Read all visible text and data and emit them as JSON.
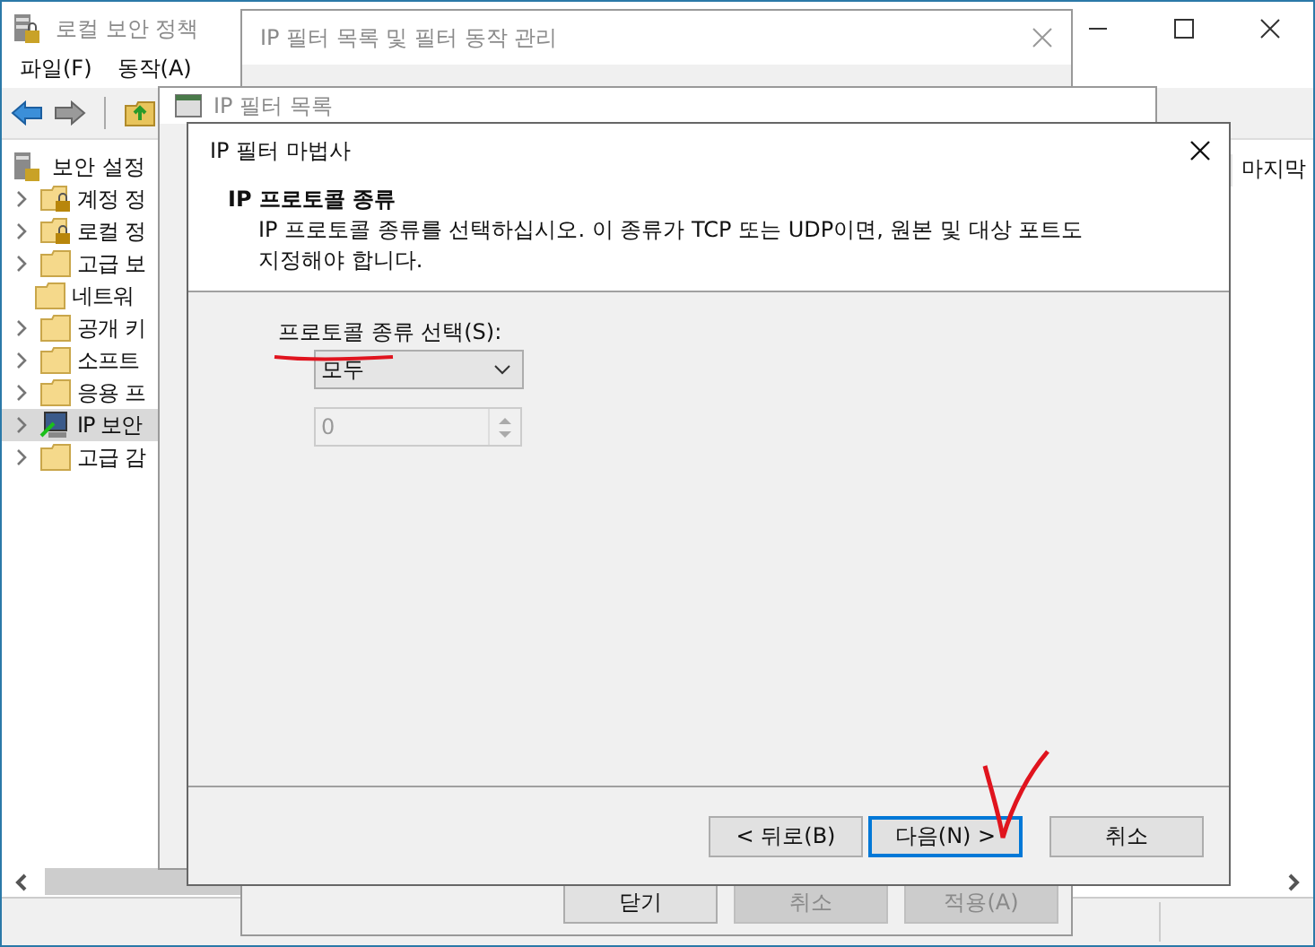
{
  "main_window": {
    "title": "로컬 보안 정책",
    "menu": [
      "파일(F)",
      "동작(A)"
    ],
    "tree": {
      "label": "보안 설정",
      "children": [
        {
          "label": "계정 정",
          "kind": "locked-folder",
          "expandable": true,
          "selected": false
        },
        {
          "label": "로컬 정",
          "kind": "locked-folder",
          "expandable": true,
          "selected": false
        },
        {
          "label": "고급 보",
          "kind": "folder",
          "expandable": true,
          "selected": false
        },
        {
          "label": "네트워",
          "kind": "folder",
          "expandable": false,
          "selected": false
        },
        {
          "label": "공개 키",
          "kind": "folder",
          "expandable": true,
          "selected": false
        },
        {
          "label": "소프트",
          "kind": "folder",
          "expandable": true,
          "selected": false
        },
        {
          "label": "응용 프",
          "kind": "folder",
          "expandable": true,
          "selected": false
        },
        {
          "label": "IP 보안",
          "kind": "computer",
          "expandable": true,
          "selected": true
        },
        {
          "label": "고급 감",
          "kind": "folder",
          "expandable": true,
          "selected": false
        }
      ]
    },
    "column_header": "마지막"
  },
  "filter_manager": {
    "title": "IP 필터 목록 및 필터 동작 관리",
    "buttons": [
      {
        "label": "닫기",
        "disabled": false
      },
      {
        "label": "취소",
        "disabled": true
      },
      {
        "label": "적용(A)",
        "disabled": true
      }
    ]
  },
  "filter_list": {
    "title": "IP 필터 목록"
  },
  "wizard": {
    "title": "IP 필터 마법사",
    "heading": "IP 프로토콜 종류",
    "description_lines": [
      "IP 프로토콜 종류를 선택하십시오. 이 종류가 TCP 또는 UDP이면, 원본 및 대상 포트도",
      "지정해야 합니다."
    ],
    "protocol_label": "프로토콜 종류 선택(S):",
    "protocol_value": "모두",
    "port": {
      "value": "0",
      "disabled": true
    },
    "buttons": [
      {
        "label": "< 뒤로(B)",
        "focused": false
      },
      {
        "label": "다음(N) >",
        "focused": true
      },
      {
        "label": "취소",
        "focused": false
      }
    ]
  }
}
